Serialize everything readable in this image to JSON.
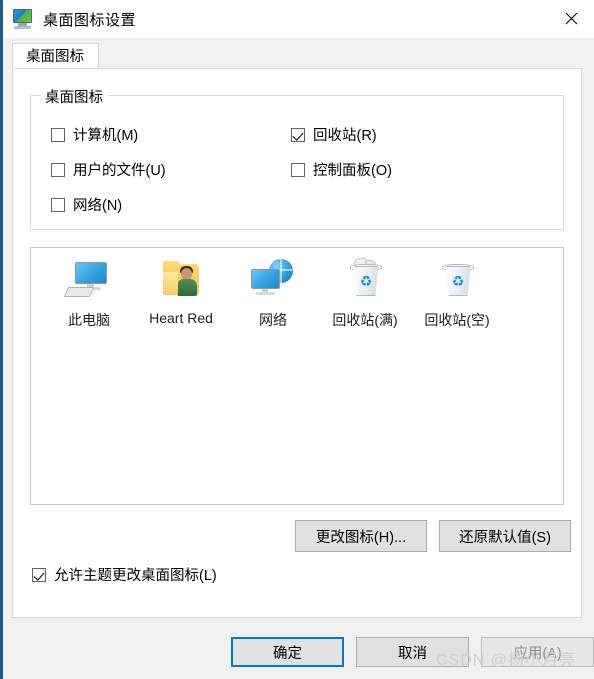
{
  "window": {
    "title": "桌面图标设置",
    "title_icon": "monitor-settings-icon",
    "close_label": "✕"
  },
  "tabs": [
    {
      "label": "桌面图标",
      "active": true
    }
  ],
  "group": {
    "legend": "桌面图标",
    "checkboxes": [
      {
        "label": "计算机(M)",
        "checked": false,
        "name": "checkbox-computer"
      },
      {
        "label": "用户的文件(U)",
        "checked": false,
        "name": "checkbox-user-files"
      },
      {
        "label": "网络(N)",
        "checked": false,
        "name": "checkbox-network"
      },
      {
        "label": "回收站(R)",
        "checked": true,
        "name": "checkbox-recycle-bin"
      },
      {
        "label": "控制面板(O)",
        "checked": false,
        "name": "checkbox-control-panel"
      }
    ]
  },
  "preview": {
    "icons": [
      {
        "label": "此电脑",
        "icon": "this-pc-icon"
      },
      {
        "label": "Heart Red",
        "icon": "user-folder-icon"
      },
      {
        "label": "网络",
        "icon": "network-icon"
      },
      {
        "label": "回收站(满)",
        "icon": "recycle-bin-full-icon"
      },
      {
        "label": "回收站(空)",
        "icon": "recycle-bin-empty-icon"
      }
    ]
  },
  "mid_buttons": {
    "change_icon": "更改图标(H)...",
    "restore_default": "还原默认值(S)"
  },
  "theme_checkbox": {
    "label": "允许主题更改桌面图标(L)",
    "checked": true
  },
  "footer_buttons": {
    "ok": "确定",
    "cancel": "取消",
    "apply": "应用(A)"
  },
  "watermark": "CSDN @杨小月亮",
  "colors": {
    "accent": "#0078d7",
    "window_bg": "#f0f0f0",
    "panel_bg": "#ffffff",
    "button_bg": "#e1e1e1",
    "disabled_text": "#8d8d8d"
  }
}
